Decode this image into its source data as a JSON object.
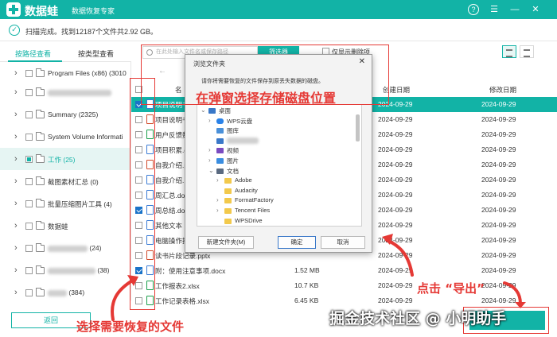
{
  "app": {
    "brand": "数据蛙",
    "subtitle": "数据恢复专家",
    "status": "扫描完成。找到12187个文件共2.92 GB。"
  },
  "tabs": [
    {
      "label": "按路径查看"
    },
    {
      "label": "按类型查看"
    }
  ],
  "toolbar": {
    "search_placeholder": "在此处输入文件名或保存路径",
    "filter_label": "筛选器",
    "deleted_only_label": "仅显示删除项"
  },
  "sidebar": {
    "items": [
      {
        "label": "Program Files (x86) (3010"
      },
      {
        "label": ""
      },
      {
        "label": "Summary (2325)"
      },
      {
        "label": "System Volume Informati"
      },
      {
        "label": "工作 (25)"
      },
      {
        "label": "截图素材汇总 (0)"
      },
      {
        "label": "批量压缩图片工具 (4)"
      },
      {
        "label": "数据蛙"
      },
      {
        "label": "(24)"
      },
      {
        "label": "(38)"
      },
      {
        "label": "(384)"
      }
    ],
    "back_label": "返回"
  },
  "table": {
    "headers": {
      "name": "名",
      "created": "创建日期",
      "modified": "修改日期"
    },
    "rows": [
      {
        "name": "项目说明书",
        "size": "",
        "created": "2024-09-29",
        "modified": "2024-09-29",
        "type": "doc"
      },
      {
        "name": "项目说明书",
        "size": "",
        "created": "2024-09-29",
        "modified": "2024-09-29",
        "type": "ppt"
      },
      {
        "name": "用户反馈数",
        "size": "",
        "created": "2024-09-29",
        "modified": "2024-09-29",
        "type": "xls"
      },
      {
        "name": "项目积累.do",
        "size": "",
        "created": "2024-09-29",
        "modified": "2024-09-29",
        "type": "doc"
      },
      {
        "name": "自我介绍.p",
        "size": "",
        "created": "2024-09-29",
        "modified": "2024-09-29",
        "type": "ppt"
      },
      {
        "name": "自我介绍.",
        "size": "",
        "created": "2024-09-29",
        "modified": "2024-09-29",
        "type": "doc"
      },
      {
        "name": "周汇总.doc",
        "size": "",
        "created": "2024-09-29",
        "modified": "2024-09-29",
        "type": "doc"
      },
      {
        "name": "周总结.do",
        "size": "",
        "created": "2024-09-29",
        "modified": "2024-09-29",
        "type": "doc"
      },
      {
        "name": "其他文本",
        "size": "",
        "created": "2024-09-29",
        "modified": "2024-09-29",
        "type": "doc"
      },
      {
        "name": "电脑操作技",
        "size": "",
        "created": "2024-09-29",
        "modified": "2024-09-29",
        "type": "doc"
      },
      {
        "name": "读书片段记录.pptx",
        "size": "",
        "created": "2024-09-29",
        "modified": "2024-09-29",
        "type": "ppt"
      },
      {
        "name": "附：使用注意事项.docx",
        "size": "1.52 MB",
        "created": "2024-09-29",
        "modified": "2024-09-29",
        "type": "doc"
      },
      {
        "name": "工作报表2.xlsx",
        "size": "10.7 KB",
        "created": "2024-09-29",
        "modified": "2024-09-29",
        "type": "xls"
      },
      {
        "name": "工作记录表格.xlsx",
        "size": "6.45 KB",
        "created": "2024-09-29",
        "modified": "2024-09-29",
        "type": "xls"
      }
    ]
  },
  "dialog": {
    "title": "浏览文件夹",
    "message": "请你将需要恢复的文件保存到原丢失数据的磁盘。",
    "tree": [
      {
        "label": "桌面",
        "icon": "desktop-icon"
      },
      {
        "label": "WPS云盘",
        "icon": "cloud-icon"
      },
      {
        "label": "图库",
        "icon": "gallery-icon"
      },
      {
        "label": "",
        "icon": "user-icon"
      },
      {
        "label": "视频",
        "icon": "video-icon"
      },
      {
        "label": "图片",
        "icon": "picture-icon"
      },
      {
        "label": "文档",
        "icon": "document-icon"
      },
      {
        "label": "Adobe",
        "icon": "folder-icon"
      },
      {
        "label": "Audacity",
        "icon": "folder-icon"
      },
      {
        "label": "FormatFactory",
        "icon": "folder-icon"
      },
      {
        "label": "Tencent Files",
        "icon": "folder-icon"
      },
      {
        "label": "WPSDrive",
        "icon": "folder-icon"
      }
    ],
    "new_folder_label": "新建文件夹(M)",
    "ok_label": "确定",
    "cancel_label": "取消"
  },
  "annotations": {
    "dialog_hint": "在弹窗选择存储磁盘位置",
    "select_hint": "选择需要恢复的文件",
    "export_hint": "点击 “导出”",
    "watermark": "掘金技术社区 @ 小明助手"
  },
  "colors": {
    "accent": "#12b3a6",
    "annotation": "#e53935",
    "checkbox": "#1a73c8"
  }
}
